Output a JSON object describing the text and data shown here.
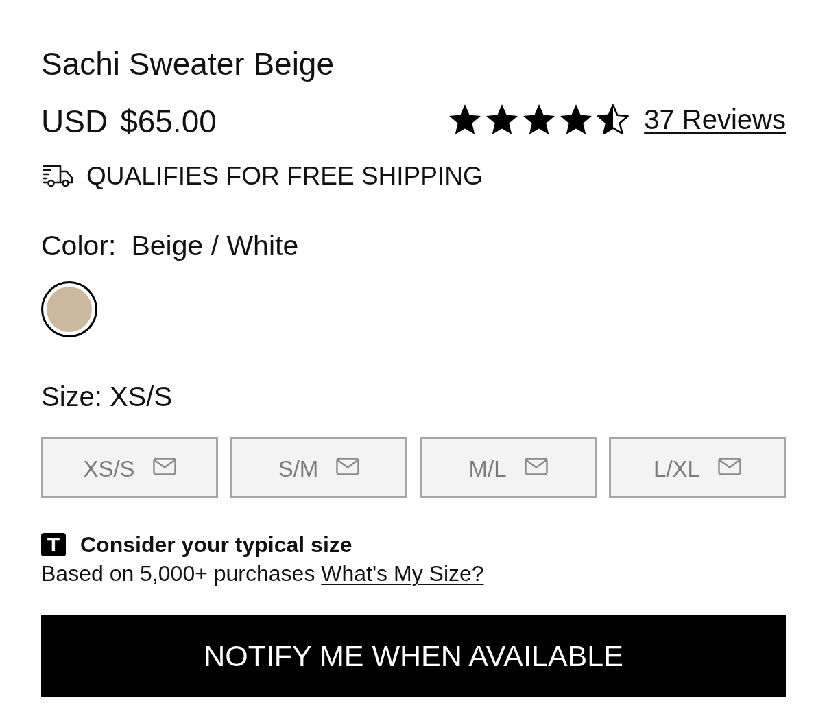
{
  "product": {
    "title": "Sachi Sweater Beige",
    "currency": "USD",
    "price": "$65.00"
  },
  "rating": {
    "stars": 4.5,
    "reviews_link": "37 Reviews"
  },
  "shipping": {
    "text": "QUALIFIES FOR FREE SHIPPING"
  },
  "color": {
    "label": "Color:",
    "value": "Beige / White",
    "swatches": [
      {
        "color": "#cdb8a0",
        "selected": true
      }
    ]
  },
  "size": {
    "label": "Size:",
    "value": "XS/S",
    "options": [
      {
        "label": "XS/S",
        "disabled": true
      },
      {
        "label": "S/M",
        "disabled": true
      },
      {
        "label": "M/L",
        "disabled": true
      },
      {
        "label": "L/XL",
        "disabled": true
      }
    ]
  },
  "fit": {
    "badge": "T",
    "title": "Consider your typical size",
    "note": "Based on 5,000+ purchases",
    "link": "What's My Size?"
  },
  "notify_button": "NOTIFY ME WHEN AVAILABLE"
}
